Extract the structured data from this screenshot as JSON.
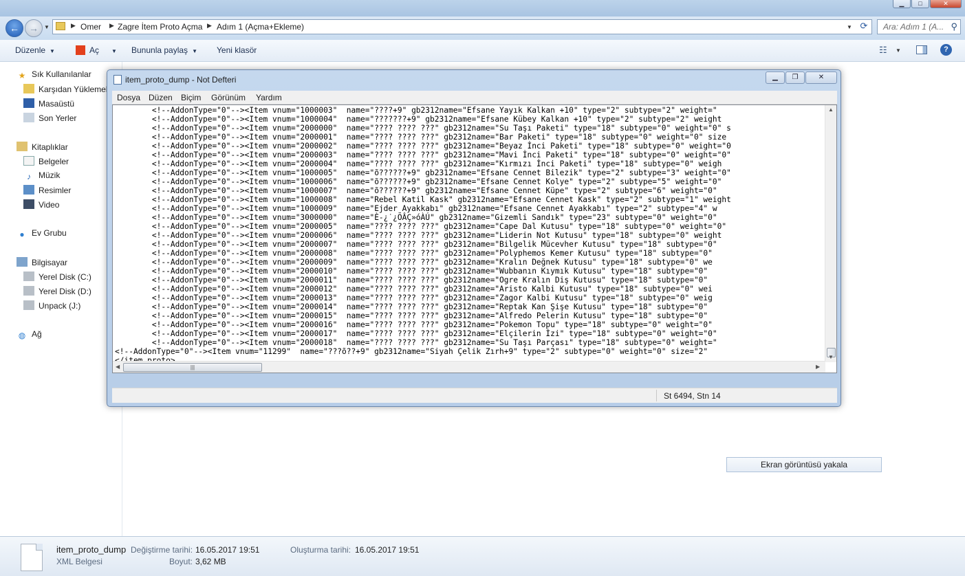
{
  "explorer": {
    "breadcrumbs": [
      "Omer",
      "Zagre İtem Proto Açma",
      "Adım 1 (Açma+Ekleme)"
    ],
    "search_placeholder": "Ara: Adım 1 (A...",
    "toolbar": {
      "organize": "Düzenle",
      "open": "Aç",
      "share": "Bununla paylaş",
      "new_folder": "Yeni klasör"
    },
    "sidebar": {
      "favorites": "Sık Kullanılanlar",
      "downloads": "Karşıdan Yüklemeler",
      "desktop": "Masaüstü",
      "recent": "Son Yerler",
      "libraries": "Kitaplıklar",
      "documents": "Belgeler",
      "music": "Müzik",
      "pictures": "Resimler",
      "video": "Video",
      "homegroup": "Ev Grubu",
      "computer": "Bilgisayar",
      "disk_c": "Yerel Disk (C:)",
      "disk_d": "Yerel Disk (D:)",
      "disk_j": "Unpack (J:)",
      "network": "Ağ"
    },
    "details": {
      "filename": "item_proto_dump",
      "filetype": "XML Belgesi",
      "modified_label": "Değiştirme tarihi:",
      "modified_value": "16.05.2017 19:51",
      "size_label": "Boyut:",
      "size_value": "3,62 MB",
      "created_label": "Oluşturma tarihi:",
      "created_value": "16.05.2017 19:51"
    },
    "screenshot_button": "Ekran görüntüsü yakala"
  },
  "notepad": {
    "title": "item_proto_dump - Not Defteri",
    "menu": [
      "Dosya",
      "Düzen",
      "Biçim",
      "Görünüm",
      "Yardım"
    ],
    "status": "St 6494, Stn 14",
    "lines": [
      "\t<!--AddonType=\"0\"--><Item vnum=\"1000003\"  name=\"????+9\" gb2312name=\"Efsane Yayık Kalkan +10\" type=\"2\" subtype=\"2\" weight=\"",
      "\t<!--AddonType=\"0\"--><Item vnum=\"1000004\"  name=\"???????+9\" gb2312name=\"Efsane Kübey Kalkan +10\" type=\"2\" subtype=\"2\" weight",
      "\t<!--AddonType=\"0\"--><Item vnum=\"2000000\"  name=\"???? ???? ???\" gb2312name=\"Su Taşı Paketi\" type=\"18\" subtype=\"0\" weight=\"0\" s",
      "\t<!--AddonType=\"0\"--><Item vnum=\"2000001\"  name=\"???? ???? ???\" gb2312name=\"Bar Paketi\" type=\"18\" subtype=\"0\" weight=\"0\" size",
      "\t<!--AddonType=\"0\"--><Item vnum=\"2000002\"  name=\"???? ???? ???\" gb2312name=\"Beyaz İnci Paketi\" type=\"18\" subtype=\"0\" weight=\"0",
      "\t<!--AddonType=\"0\"--><Item vnum=\"2000003\"  name=\"???? ???? ???\" gb2312name=\"Mavi İnci Paketi\" type=\"18\" subtype=\"0\" weight=\"0\"",
      "\t<!--AddonType=\"0\"--><Item vnum=\"2000004\"  name=\"???? ???? ???\" gb2312name=\"Kırmızı İnci Paketi\" type=\"18\" subtype=\"0\" weigh",
      "\t<!--AddonType=\"0\"--><Item vnum=\"1000005\"  name=\"õ??????+9\" gb2312name=\"Efsane Cennet Bilezik\" type=\"2\" subtype=\"3\" weight=\"0\"",
      "\t<!--AddonType=\"0\"--><Item vnum=\"1000006\"  name=\"õ??????+9\" gb2312name=\"Efsane Cennet Kolye\" type=\"2\" subtype=\"5\" weight=\"0\"",
      "\t<!--AddonType=\"0\"--><Item vnum=\"1000007\"  name=\"õ??????+9\" gb2312name=\"Efsane Cennet Küpe\" type=\"2\" subtype=\"6\" weight=\"0\"",
      "\t<!--AddonType=\"0\"--><Item vnum=\"1000008\"  name=\"Rebel Katil Kask\" gb2312name=\"Efsane Cennet Kask\" type=\"2\" subtype=\"1\" weight",
      "\t<!--AddonType=\"0\"--><Item vnum=\"1000009\"  name=\"Ejder Ayakkabı\" gb2312name=\"Efsane Cennet Ayakkabı\" type=\"2\" subtype=\"4\" w",
      "\t<!--AddonType=\"0\"--><Item vnum=\"3000000\"  name=\"È-¿˙¿ÕÂÇ»óÀÚ\" gb2312name=\"Gizemli Sandık\" type=\"23\" subtype=\"0\" weight=\"0\"",
      "\t<!--AddonType=\"0\"--><Item vnum=\"2000005\"  name=\"???? ???? ???\" gb2312name=\"Cape Dal Kutusu\" type=\"18\" subtype=\"0\" weight=\"0\"",
      "\t<!--AddonType=\"0\"--><Item vnum=\"2000006\"  name=\"???? ???? ???\" gb2312name=\"Liderin Not Kutusu\" type=\"18\" subtype=\"0\" weight",
      "\t<!--AddonType=\"0\"--><Item vnum=\"2000007\"  name=\"???? ???? ???\" gb2312name=\"Bilgelik Mücevher Kutusu\" type=\"18\" subtype=\"0\"",
      "\t<!--AddonType=\"0\"--><Item vnum=\"2000008\"  name=\"???? ???? ???\" gb2312name=\"Polyphemos Kemer Kutusu\" type=\"18\" subtype=\"0\"",
      "\t<!--AddonType=\"0\"--><Item vnum=\"2000009\"  name=\"???? ???? ???\" gb2312name=\"Kralın Değnek Kutusu\" type=\"18\" subtype=\"0\" we",
      "\t<!--AddonType=\"0\"--><Item vnum=\"2000010\"  name=\"???? ???? ???\" gb2312name=\"Wubbanın Kıymık Kutusu\" type=\"18\" subtype=\"0\"",
      "\t<!--AddonType=\"0\"--><Item vnum=\"2000011\"  name=\"???? ???? ???\" gb2312name=\"Ogre Kralın Diş Kutusu\" type=\"18\" subtype=\"0\"",
      "\t<!--AddonType=\"0\"--><Item vnum=\"2000012\"  name=\"???? ???? ???\" gb2312name=\"Aristo Kalbi Kutusu\" type=\"18\" subtype=\"0\" wei",
      "\t<!--AddonType=\"0\"--><Item vnum=\"2000013\"  name=\"???? ???? ???\" gb2312name=\"Zagor Kalbi Kutusu\" type=\"18\" subtype=\"0\" weig",
      "\t<!--AddonType=\"0\"--><Item vnum=\"2000014\"  name=\"???? ???? ???\" gb2312name=\"Reptak Kan Şişe Kutusu\" type=\"18\" subtype=\"0\"",
      "\t<!--AddonType=\"0\"--><Item vnum=\"2000015\"  name=\"???? ???? ???\" gb2312name=\"Alfredo Pelerin Kutusu\" type=\"18\" subtype=\"0\"",
      "\t<!--AddonType=\"0\"--><Item vnum=\"2000016\"  name=\"???? ???? ???\" gb2312name=\"Pokemon Topu\" type=\"18\" subtype=\"0\" weight=\"0\"",
      "\t<!--AddonType=\"0\"--><Item vnum=\"2000017\"  name=\"???? ???? ???\" gb2312name=\"Elçilerin İzi\" type=\"18\" subtype=\"0\" weight=\"0\"",
      "\t<!--AddonType=\"0\"--><Item vnum=\"2000018\"  name=\"???? ???? ???\" gb2312name=\"Su Taşı Parçası\" type=\"18\" subtype=\"0\" weight=\"",
      "<!--AddonType=\"0\"--><Item vnum=\"11299\"  name=\"???õ??+9\" gb2312name=\"Siyah Çelik Zırh+9\" type=\"2\" subtype=\"0\" weight=\"0\" size=\"2\"",
      "</item_proto>"
    ]
  },
  "icons": {
    "back": "back-arrow-icon",
    "forward": "forward-arrow-icon",
    "search": "search-icon",
    "refresh": "refresh-icon",
    "help": "help-icon"
  }
}
